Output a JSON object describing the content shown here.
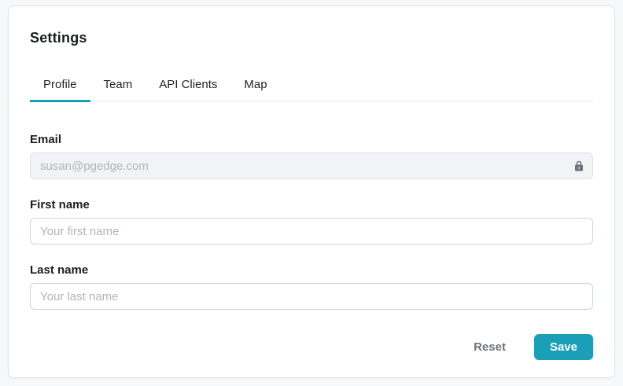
{
  "page_title": "Settings",
  "tabs": [
    {
      "label": "Profile",
      "active": true
    },
    {
      "label": "Team",
      "active": false
    },
    {
      "label": "API Clients",
      "active": false
    },
    {
      "label": "Map",
      "active": false
    }
  ],
  "fields": {
    "email": {
      "label": "Email",
      "value": "susan@pgedge.com",
      "locked": true,
      "lock_icon": "lock-icon"
    },
    "first_name": {
      "label": "First name",
      "value": "",
      "placeholder": "Your first name"
    },
    "last_name": {
      "label": "Last name",
      "value": "",
      "placeholder": "Your last name"
    }
  },
  "actions": {
    "reset_label": "Reset",
    "save_label": "Save"
  },
  "colors": {
    "accent_teal": "#1b9fb8",
    "disabled_field_bg": "#f1f3f5",
    "card_border": "#dee2e6",
    "placeholder_text": "#adb5bd"
  }
}
